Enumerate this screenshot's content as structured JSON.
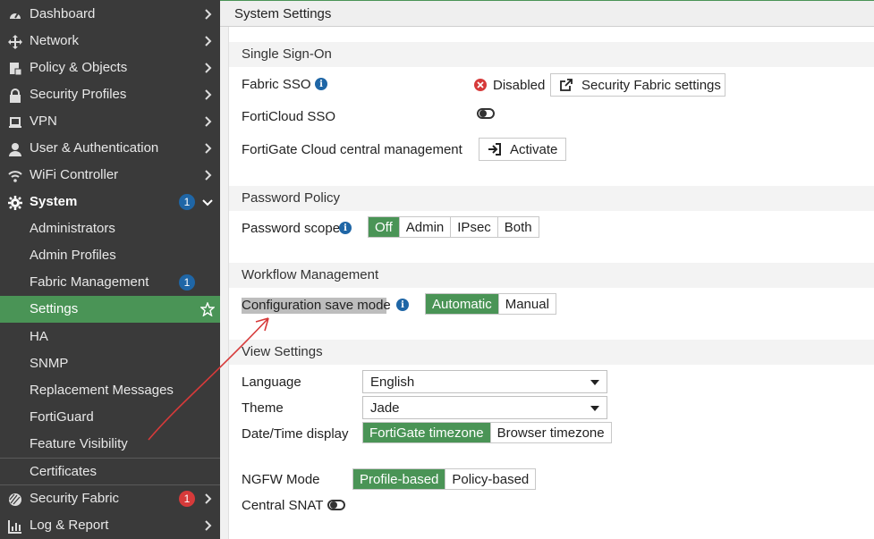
{
  "sidebar": {
    "items": [
      {
        "label": "Dashboard",
        "icon": "dashboard-icon"
      },
      {
        "label": "Network",
        "icon": "network-icon"
      },
      {
        "label": "Policy & Objects",
        "icon": "policy-icon"
      },
      {
        "label": "Security Profiles",
        "icon": "lock-icon"
      },
      {
        "label": "VPN",
        "icon": "laptop-icon"
      },
      {
        "label": "User & Authentication",
        "icon": "user-icon"
      },
      {
        "label": "WiFi Controller",
        "icon": "wifi-icon"
      },
      {
        "label": "System",
        "icon": "gear-icon",
        "badge": "1"
      }
    ],
    "sub_items": [
      {
        "label": "Administrators"
      },
      {
        "label": "Admin Profiles"
      },
      {
        "label": "Fabric Management",
        "badge": "1"
      },
      {
        "label": "Settings"
      },
      {
        "label": "HA"
      },
      {
        "label": "SNMP"
      },
      {
        "label": "Replacement Messages"
      },
      {
        "label": "FortiGuard"
      },
      {
        "label": "Feature Visibility"
      },
      {
        "label": "Certificates"
      }
    ],
    "bottom_items": [
      {
        "label": "Security Fabric",
        "icon": "fabric-icon",
        "badge": "1"
      },
      {
        "label": "Log & Report",
        "icon": "chart-icon"
      }
    ]
  },
  "page": {
    "title": "System Settings"
  },
  "sso": {
    "section_title": "Single Sign-On",
    "fabric_sso_label": "Fabric SSO",
    "fabric_sso_status": "Disabled",
    "fabric_settings_button": "Security Fabric settings",
    "forticloud_sso_label": "FortiCloud SSO",
    "fortigate_cloud_label": "FortiGate Cloud central management",
    "activate_button": "Activate"
  },
  "password_policy": {
    "section_title": "Password Policy",
    "scope_label": "Password scope",
    "options": [
      "Off",
      "Admin",
      "IPsec",
      "Both"
    ],
    "selected": "Off"
  },
  "workflow": {
    "section_title": "Workflow Management",
    "config_save_label": "Configuration save mode",
    "options": [
      "Automatic",
      "Manual"
    ],
    "selected": "Automatic"
  },
  "view_settings": {
    "section_title": "View Settings",
    "language_label": "Language",
    "language_value": "English",
    "theme_label": "Theme",
    "theme_value": "Jade",
    "datetime_label": "Date/Time display",
    "datetime_options": [
      "FortiGate timezone",
      "Browser timezone"
    ],
    "datetime_selected": "FortiGate timezone",
    "ngfw_label": "NGFW Mode",
    "ngfw_options": [
      "Profile-based",
      "Policy-based"
    ],
    "ngfw_selected": "Profile-based",
    "central_snat_label": "Central SNAT"
  },
  "colors": {
    "accent": "#4a9456",
    "sidebar": "#3a3a3a",
    "info": "#1f66a6",
    "annotation": "#d63a3a"
  }
}
